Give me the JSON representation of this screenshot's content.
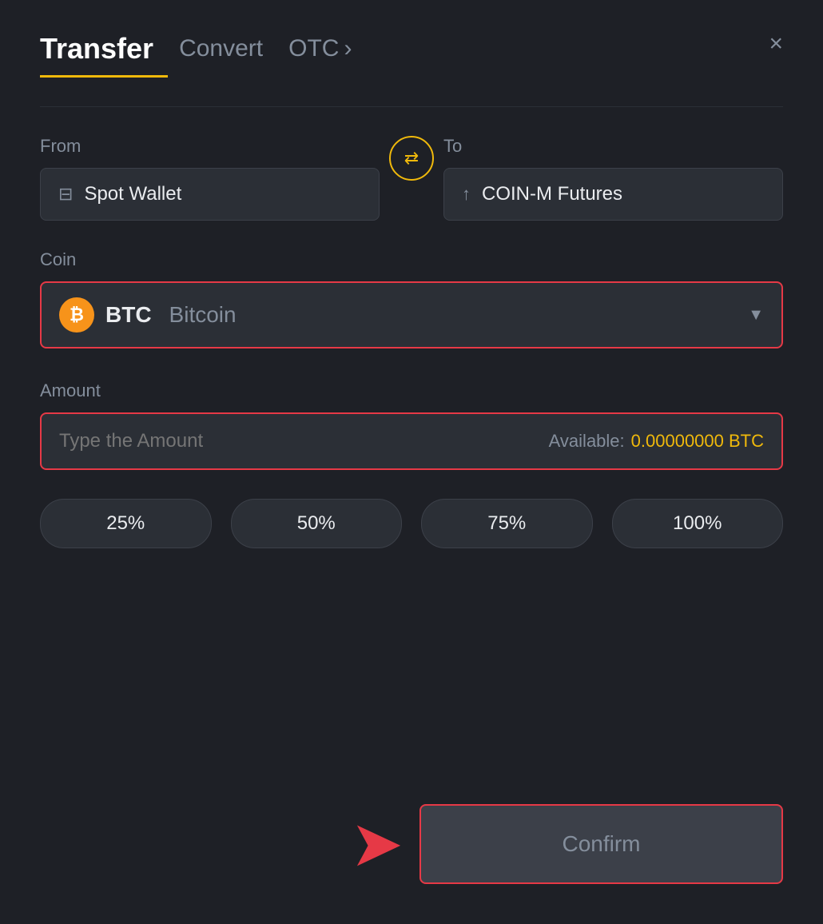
{
  "header": {
    "title": "Transfer",
    "tabs": [
      {
        "label": "Convert",
        "active": false
      },
      {
        "label": "OTC",
        "active": false
      },
      {
        "otc_arrow": "›"
      }
    ],
    "close_label": "×"
  },
  "from": {
    "label": "From",
    "wallet_icon": "▬",
    "wallet_name": "Spot Wallet"
  },
  "to": {
    "label": "To",
    "futures_icon": "↑",
    "futures_name": "COIN-M Futures"
  },
  "coin": {
    "label": "Coin",
    "btc_symbol": "BTC",
    "btc_fullname": "Bitcoin",
    "btc_icon_char": "₿"
  },
  "amount": {
    "label": "Amount",
    "placeholder": "Type the Amount",
    "available_label": "Available:",
    "available_value": "0.00000000 BTC"
  },
  "percentages": [
    "25%",
    "50%",
    "75%",
    "100%"
  ],
  "confirm": {
    "label": "Confirm"
  }
}
